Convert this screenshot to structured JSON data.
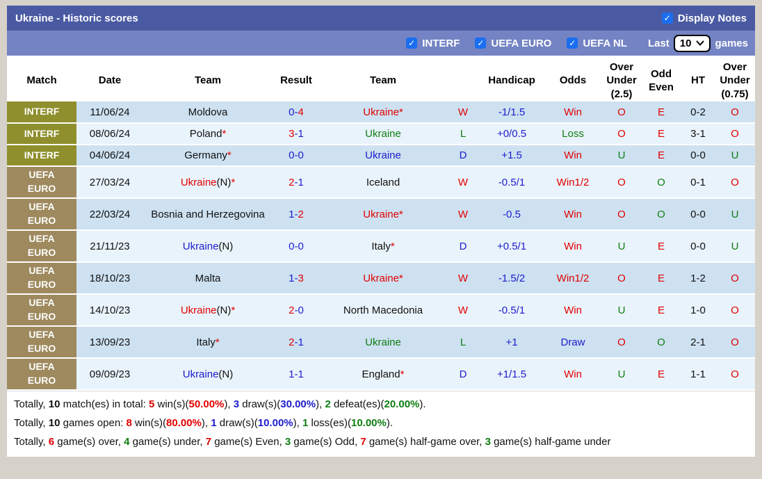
{
  "colors": {
    "red": "#e10000",
    "blue": "#1c1ccd",
    "green": "#0e7d12",
    "black": "#111111",
    "title_bar": "#4a5aa2",
    "filter_bar": "#7383c3",
    "checkbox_blue": "#1a6ef0",
    "row_dark": "#cde1f1",
    "row_light": "#e9f3fb",
    "interf_label_bg": "#8f8f2d",
    "uefa_label_bg": "#9e8a5e"
  },
  "title_bar": {
    "title": "Ukraine - Historic scores",
    "display_notes_label": "Display Notes"
  },
  "filter_bar": {
    "filters": [
      {
        "label": "INTERF",
        "checked": true
      },
      {
        "label": "UEFA EURO",
        "checked": true
      },
      {
        "label": "UEFA NL",
        "checked": true
      }
    ],
    "last_label": "Last",
    "games_count": "10",
    "games_label": "games"
  },
  "table": {
    "headers": [
      "Match",
      "Date",
      "Team",
      "Result",
      "Team",
      "",
      "Handicap",
      "Odds",
      "Over Under (2.5)",
      "Odd Even",
      "HT",
      "Over Under (0.75)"
    ],
    "rows": [
      {
        "league": [
          "INTERF"
        ],
        "ltype": "interf",
        "shade": "dark",
        "date": "11/06/24",
        "team1": [
          {
            "t": "Moldova",
            "c": "black"
          }
        ],
        "result": [
          {
            "t": "0-",
            "c": "blue"
          },
          {
            "t": "4",
            "c": "red"
          }
        ],
        "team2": [
          {
            "t": "Ukraine*",
            "c": "red"
          }
        ],
        "wld": {
          "t": "W",
          "c": "red"
        },
        "handicap": "-1/1.5",
        "odds": {
          "t": "Win",
          "c": "red"
        },
        "ou25": {
          "t": "O",
          "c": "red"
        },
        "oddeven": {
          "t": "E",
          "c": "red"
        },
        "ht": "0-2",
        "ou075": {
          "t": "O",
          "c": "red"
        }
      },
      {
        "league": [
          "INTERF"
        ],
        "ltype": "interf",
        "shade": "light",
        "date": "08/06/24",
        "team1": [
          {
            "t": "Poland",
            "c": "black"
          },
          {
            "t": "*",
            "c": "red"
          }
        ],
        "result": [
          {
            "t": "3",
            "c": "red"
          },
          {
            "t": "-1",
            "c": "blue"
          }
        ],
        "team2": [
          {
            "t": "Ukraine",
            "c": "green"
          }
        ],
        "wld": {
          "t": "L",
          "c": "green"
        },
        "handicap": "+0/0.5",
        "odds": {
          "t": "Loss",
          "c": "green"
        },
        "ou25": {
          "t": "O",
          "c": "red"
        },
        "oddeven": {
          "t": "E",
          "c": "red"
        },
        "ht": "3-1",
        "ou075": {
          "t": "O",
          "c": "red"
        }
      },
      {
        "league": [
          "INTERF"
        ],
        "ltype": "interf",
        "shade": "dark",
        "date": "04/06/24",
        "team1": [
          {
            "t": "Germany",
            "c": "black"
          },
          {
            "t": "*",
            "c": "red"
          }
        ],
        "result": [
          {
            "t": "0-0",
            "c": "blue"
          }
        ],
        "team2": [
          {
            "t": "Ukraine",
            "c": "blue"
          }
        ],
        "wld": {
          "t": "D",
          "c": "blue"
        },
        "handicap": "+1.5",
        "odds": {
          "t": "Win",
          "c": "red"
        },
        "ou25": {
          "t": "U",
          "c": "green"
        },
        "oddeven": {
          "t": "E",
          "c": "red"
        },
        "ht": "0-0",
        "ou075": {
          "t": "U",
          "c": "green"
        }
      },
      {
        "league": [
          "UEFA",
          "EURO"
        ],
        "ltype": "euro",
        "shade": "light",
        "date": "27/03/24",
        "team1": [
          {
            "t": "Ukraine",
            "c": "red"
          },
          {
            "t": "(N)",
            "c": "black"
          },
          {
            "t": "*",
            "c": "red"
          }
        ],
        "result": [
          {
            "t": "2",
            "c": "red"
          },
          {
            "t": "-1",
            "c": "blue"
          }
        ],
        "team2": [
          {
            "t": "Iceland",
            "c": "black"
          }
        ],
        "wld": {
          "t": "W",
          "c": "red"
        },
        "handicap": "-0.5/1",
        "odds": {
          "t": "Win1/2",
          "c": "red"
        },
        "ou25": {
          "t": "O",
          "c": "red"
        },
        "oddeven": {
          "t": "O",
          "c": "green"
        },
        "ht": "0-1",
        "ou075": {
          "t": "O",
          "c": "red"
        }
      },
      {
        "league": [
          "UEFA",
          "EURO"
        ],
        "ltype": "euro",
        "shade": "dark",
        "date": "22/03/24",
        "team1": [
          {
            "t": "Bosnia and Herzegovina",
            "c": "black"
          }
        ],
        "result": [
          {
            "t": "1-",
            "c": "blue"
          },
          {
            "t": "2",
            "c": "red"
          }
        ],
        "team2": [
          {
            "t": "Ukraine*",
            "c": "red"
          }
        ],
        "wld": {
          "t": "W",
          "c": "red"
        },
        "handicap": "-0.5",
        "odds": {
          "t": "Win",
          "c": "red"
        },
        "ou25": {
          "t": "O",
          "c": "red"
        },
        "oddeven": {
          "t": "O",
          "c": "green"
        },
        "ht": "0-0",
        "ou075": {
          "t": "U",
          "c": "green"
        }
      },
      {
        "league": [
          "UEFA",
          "EURO"
        ],
        "ltype": "euro",
        "shade": "light",
        "date": "21/11/23",
        "team1": [
          {
            "t": "Ukraine",
            "c": "blue"
          },
          {
            "t": "(N)",
            "c": "black"
          }
        ],
        "result": [
          {
            "t": "0-0",
            "c": "blue"
          }
        ],
        "team2": [
          {
            "t": "Italy",
            "c": "black"
          },
          {
            "t": "*",
            "c": "red"
          }
        ],
        "wld": {
          "t": "D",
          "c": "blue"
        },
        "handicap": "+0.5/1",
        "odds": {
          "t": "Win",
          "c": "red"
        },
        "ou25": {
          "t": "U",
          "c": "green"
        },
        "oddeven": {
          "t": "E",
          "c": "red"
        },
        "ht": "0-0",
        "ou075": {
          "t": "U",
          "c": "green"
        }
      },
      {
        "league": [
          "UEFA",
          "EURO"
        ],
        "ltype": "euro",
        "shade": "dark",
        "date": "18/10/23",
        "team1": [
          {
            "t": "Malta",
            "c": "black"
          }
        ],
        "result": [
          {
            "t": "1-",
            "c": "blue"
          },
          {
            "t": "3",
            "c": "red"
          }
        ],
        "team2": [
          {
            "t": "Ukraine*",
            "c": "red"
          }
        ],
        "wld": {
          "t": "W",
          "c": "red"
        },
        "handicap": "-1.5/2",
        "odds": {
          "t": "Win1/2",
          "c": "red"
        },
        "ou25": {
          "t": "O",
          "c": "red"
        },
        "oddeven": {
          "t": "E",
          "c": "red"
        },
        "ht": "1-2",
        "ou075": {
          "t": "O",
          "c": "red"
        }
      },
      {
        "league": [
          "UEFA",
          "EURO"
        ],
        "ltype": "euro",
        "shade": "light",
        "date": "14/10/23",
        "team1": [
          {
            "t": "Ukraine",
            "c": "red"
          },
          {
            "t": "(N)",
            "c": "black"
          },
          {
            "t": "*",
            "c": "red"
          }
        ],
        "result": [
          {
            "t": "2",
            "c": "red"
          },
          {
            "t": "-0",
            "c": "blue"
          }
        ],
        "team2": [
          {
            "t": "North Macedonia",
            "c": "black"
          }
        ],
        "wld": {
          "t": "W",
          "c": "red"
        },
        "handicap": "-0.5/1",
        "odds": {
          "t": "Win",
          "c": "red"
        },
        "ou25": {
          "t": "U",
          "c": "green"
        },
        "oddeven": {
          "t": "E",
          "c": "red"
        },
        "ht": "1-0",
        "ou075": {
          "t": "O",
          "c": "red"
        }
      },
      {
        "league": [
          "UEFA",
          "EURO"
        ],
        "ltype": "euro",
        "shade": "dark",
        "date": "13/09/23",
        "team1": [
          {
            "t": "Italy",
            "c": "black"
          },
          {
            "t": "*",
            "c": "red"
          }
        ],
        "result": [
          {
            "t": "2",
            "c": "red"
          },
          {
            "t": "-1",
            "c": "blue"
          }
        ],
        "team2": [
          {
            "t": "Ukraine",
            "c": "green"
          }
        ],
        "wld": {
          "t": "L",
          "c": "green"
        },
        "handicap": "+1",
        "odds": {
          "t": "Draw",
          "c": "blue"
        },
        "ou25": {
          "t": "O",
          "c": "red"
        },
        "oddeven": {
          "t": "O",
          "c": "green"
        },
        "ht": "2-1",
        "ou075": {
          "t": "O",
          "c": "red"
        }
      },
      {
        "league": [
          "UEFA",
          "EURO"
        ],
        "ltype": "euro",
        "shade": "light",
        "date": "09/09/23",
        "team1": [
          {
            "t": "Ukraine",
            "c": "blue"
          },
          {
            "t": "(N)",
            "c": "black"
          }
        ],
        "result": [
          {
            "t": "1-1",
            "c": "blue"
          }
        ],
        "team2": [
          {
            "t": "England",
            "c": "black"
          },
          {
            "t": "*",
            "c": "red"
          }
        ],
        "wld": {
          "t": "D",
          "c": "blue"
        },
        "handicap": "+1/1.5",
        "odds": {
          "t": "Win",
          "c": "red"
        },
        "ou25": {
          "t": "U",
          "c": "green"
        },
        "oddeven": {
          "t": "E",
          "c": "red"
        },
        "ht": "1-1",
        "ou075": {
          "t": "O",
          "c": "red"
        }
      }
    ]
  },
  "footer": {
    "lines": [
      [
        {
          "t": "Totally, "
        },
        {
          "t": "10",
          "c": "black",
          "b": true
        },
        {
          "t": " match(es) in total: "
        },
        {
          "t": "5",
          "c": "red",
          "b": true
        },
        {
          "t": " win(s)("
        },
        {
          "t": "50.00%",
          "c": "red",
          "b": true
        },
        {
          "t": "), "
        },
        {
          "t": "3",
          "c": "blue",
          "b": true
        },
        {
          "t": " draw(s)("
        },
        {
          "t": "30.00%",
          "c": "blue",
          "b": true
        },
        {
          "t": "), "
        },
        {
          "t": "2",
          "c": "green",
          "b": true
        },
        {
          "t": " defeat(es)("
        },
        {
          "t": "20.00%",
          "c": "green",
          "b": true
        },
        {
          "t": ")."
        }
      ],
      [
        {
          "t": "Totally, "
        },
        {
          "t": "10",
          "c": "black",
          "b": true
        },
        {
          "t": " games open: "
        },
        {
          "t": "8",
          "c": "red",
          "b": true
        },
        {
          "t": " win(s)("
        },
        {
          "t": "80.00%",
          "c": "red",
          "b": true
        },
        {
          "t": "), "
        },
        {
          "t": "1",
          "c": "blue",
          "b": true
        },
        {
          "t": " draw(s)("
        },
        {
          "t": "10.00%",
          "c": "blue",
          "b": true
        },
        {
          "t": "), "
        },
        {
          "t": "1",
          "c": "green",
          "b": true
        },
        {
          "t": " loss(es)("
        },
        {
          "t": "10.00%",
          "c": "green",
          "b": true
        },
        {
          "t": ")."
        }
      ],
      [
        {
          "t": "Totally, "
        },
        {
          "t": "6",
          "c": "red",
          "b": true
        },
        {
          "t": " game(s) over, "
        },
        {
          "t": "4",
          "c": "green",
          "b": true
        },
        {
          "t": " game(s) under, "
        },
        {
          "t": "7",
          "c": "red",
          "b": true
        },
        {
          "t": " game(s) Even, "
        },
        {
          "t": "3",
          "c": "green",
          "b": true
        },
        {
          "t": " game(s) Odd, "
        },
        {
          "t": "7",
          "c": "red",
          "b": true
        },
        {
          "t": " game(s) half-game over, "
        },
        {
          "t": "3",
          "c": "green",
          "b": true
        },
        {
          "t": " game(s) half-game under"
        }
      ]
    ]
  }
}
